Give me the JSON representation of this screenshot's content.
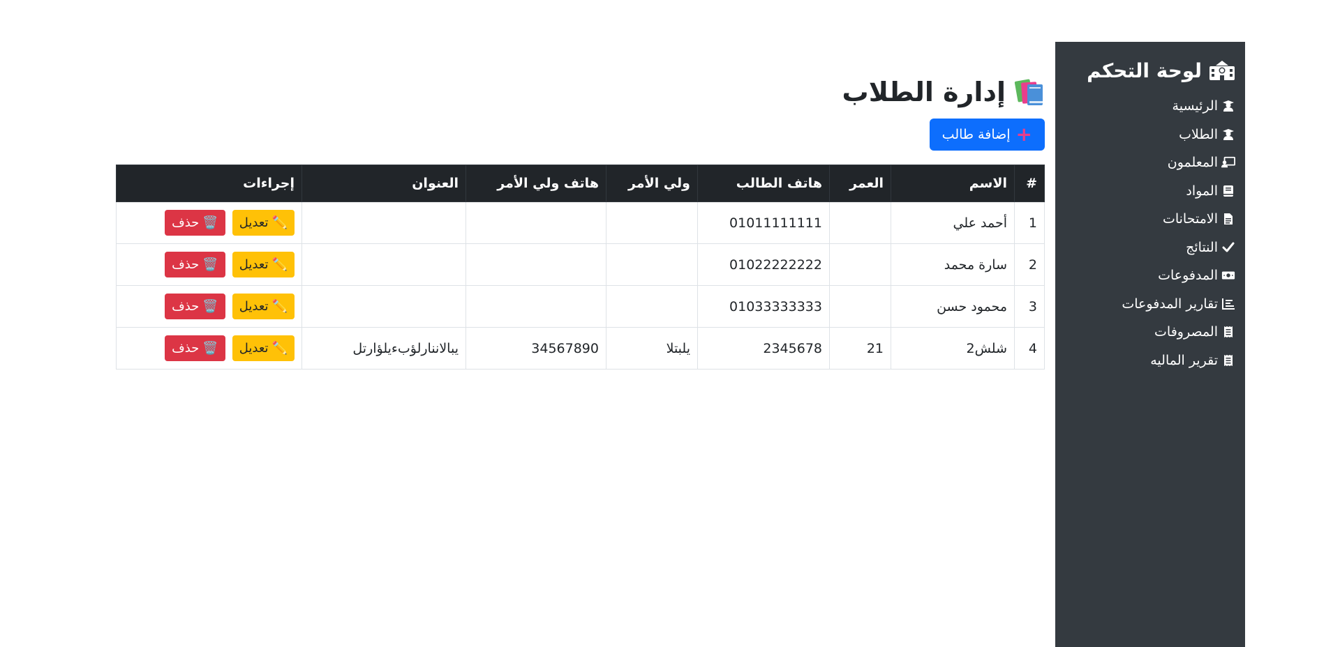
{
  "sidebar": {
    "title": "لوحة التحكم",
    "title_icon": "school-icon",
    "items": [
      {
        "label": "الرئيسية",
        "icon": "graduate-icon"
      },
      {
        "label": "الطلاب",
        "icon": "graduate-icon"
      },
      {
        "label": "المعلمون",
        "icon": "teacher-board-icon"
      },
      {
        "label": "المواد",
        "icon": "book-icon"
      },
      {
        "label": "الامتحانات",
        "icon": "file-icon"
      },
      {
        "label": "النتائج",
        "icon": "check-icon"
      },
      {
        "label": "المدفوعات",
        "icon": "money-icon"
      },
      {
        "label": "تقارير المدفوعات",
        "icon": "report-list-icon"
      },
      {
        "label": "المصروفات",
        "icon": "receipt-icon"
      },
      {
        "label": "تقرير الماليه",
        "icon": "receipt-icon"
      }
    ]
  },
  "main": {
    "title": "إدارة الطلاب",
    "title_icon": "books-icon",
    "add_button": "إضافة طالب",
    "table": {
      "headers": [
        "#",
        "الاسم",
        "العمر",
        "هاتف الطالب",
        "ولي الأمر",
        "هاتف ولي الأمر",
        "العنوان",
        "إجراءات"
      ],
      "rows": [
        {
          "id": "1",
          "name": "أحمد علي",
          "age": "",
          "phone": "01011111111",
          "guardian": "",
          "guardian_phone": "",
          "address": ""
        },
        {
          "id": "2",
          "name": "سارة محمد",
          "age": "",
          "phone": "01022222222",
          "guardian": "",
          "guardian_phone": "",
          "address": ""
        },
        {
          "id": "3",
          "name": "محمود حسن",
          "age": "",
          "phone": "01033333333",
          "guardian": "",
          "guardian_phone": "",
          "address": ""
        },
        {
          "id": "4",
          "name": "شلش2",
          "age": "21",
          "phone": "2345678",
          "guardian": "يلبتلا",
          "guardian_phone": "34567890",
          "address": "يباﻻننارلؤبءيلؤارتل"
        }
      ],
      "edit_label": "تعديل",
      "delete_label": "حذف",
      "edit_icon": "pencil-icon",
      "delete_icon": "trash-icon"
    }
  },
  "colors": {
    "sidebar_bg": "#343a40",
    "primary": "#0d6efd",
    "warning": "#ffc107",
    "danger": "#dc3545",
    "table_header": "#212529"
  }
}
